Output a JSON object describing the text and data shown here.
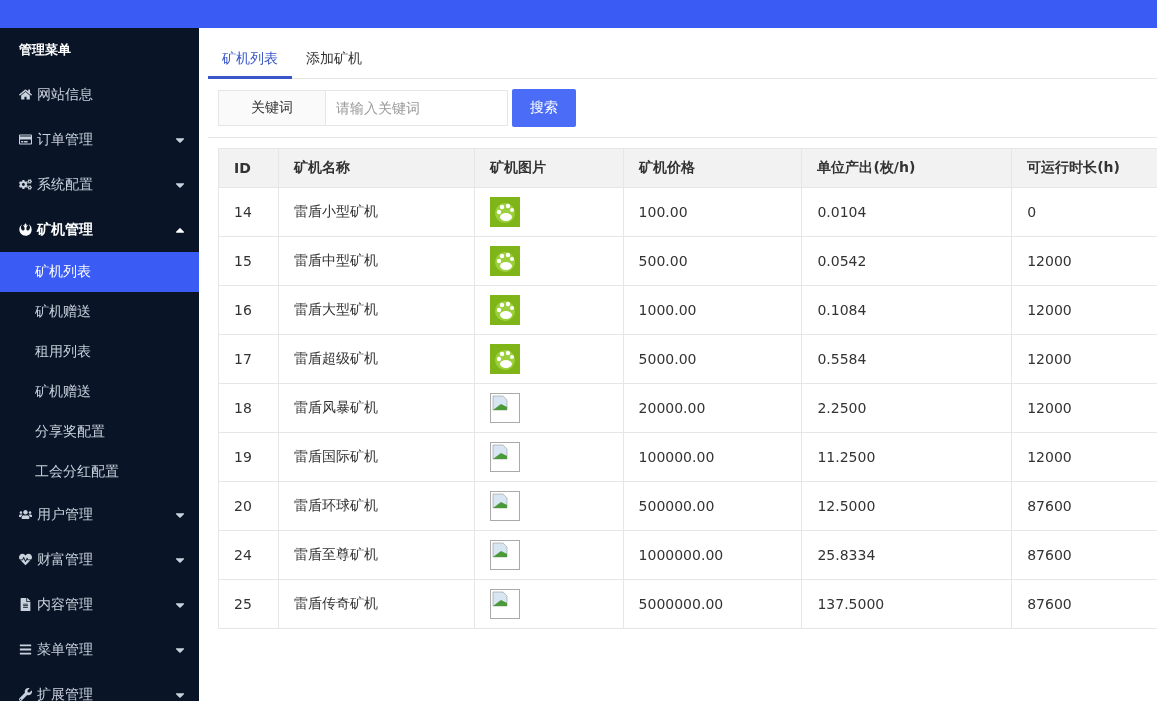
{
  "sidebar": {
    "title": "管理菜单",
    "items": [
      {
        "label": "网站信息"
      },
      {
        "label": "订单管理",
        "expanded": false
      },
      {
        "label": "系统配置",
        "expanded": false
      },
      {
        "label": "矿机管理",
        "expanded": true,
        "children": [
          {
            "label": "矿机列表",
            "selected": true
          },
          {
            "label": "矿机赠送",
            "selected": false
          },
          {
            "label": "租用列表",
            "selected": false
          },
          {
            "label": "矿机赠送",
            "selected": false
          },
          {
            "label": "分享奖配置",
            "selected": false
          },
          {
            "label": "工会分红配置",
            "selected": false
          }
        ]
      },
      {
        "label": "用户管理",
        "expanded": false
      },
      {
        "label": "财富管理",
        "expanded": false
      },
      {
        "label": "内容管理",
        "expanded": false
      },
      {
        "label": "菜单管理",
        "expanded": false
      },
      {
        "label": "扩展管理",
        "expanded": false
      }
    ]
  },
  "tabs": [
    {
      "label": "矿机列表",
      "selected": true
    },
    {
      "label": "添加矿机",
      "selected": false
    }
  ],
  "search": {
    "label": "关键词",
    "placeholder": "请输入关键词",
    "button": "搜索"
  },
  "table": {
    "columns": [
      "ID",
      "矿机名称",
      "矿机图片",
      "矿机价格",
      "单位产出(枚/h)",
      "可运行时长(h)"
    ],
    "rows": [
      {
        "id": "14",
        "name": "雷盾小型矿机",
        "kind": "logo",
        "price": "100.00",
        "output": "0.0104",
        "runtime": "0"
      },
      {
        "id": "15",
        "name": "雷盾中型矿机",
        "kind": "logo",
        "price": "500.00",
        "output": "0.0542",
        "runtime": "12000"
      },
      {
        "id": "16",
        "name": "雷盾大型矿机",
        "kind": "logo",
        "price": "1000.00",
        "output": "0.1084",
        "runtime": "12000"
      },
      {
        "id": "17",
        "name": "雷盾超级矿机",
        "kind": "logo",
        "price": "5000.00",
        "output": "0.5584",
        "runtime": "12000"
      },
      {
        "id": "18",
        "name": "雷盾风暴矿机",
        "kind": "broken",
        "price": "20000.00",
        "output": "2.2500",
        "runtime": "12000"
      },
      {
        "id": "19",
        "name": "雷盾国际矿机",
        "kind": "broken",
        "price": "100000.00",
        "output": "11.2500",
        "runtime": "12000"
      },
      {
        "id": "20",
        "name": "雷盾环球矿机",
        "kind": "broken",
        "price": "500000.00",
        "output": "12.5000",
        "runtime": "87600"
      },
      {
        "id": "24",
        "name": "雷盾至尊矿机",
        "kind": "broken",
        "price": "1000000.00",
        "output": "25.8334",
        "runtime": "87600"
      },
      {
        "id": "25",
        "name": "雷盾传奇矿机",
        "kind": "broken",
        "price": "5000000.00",
        "output": "137.5000",
        "runtime": "87600"
      }
    ]
  }
}
